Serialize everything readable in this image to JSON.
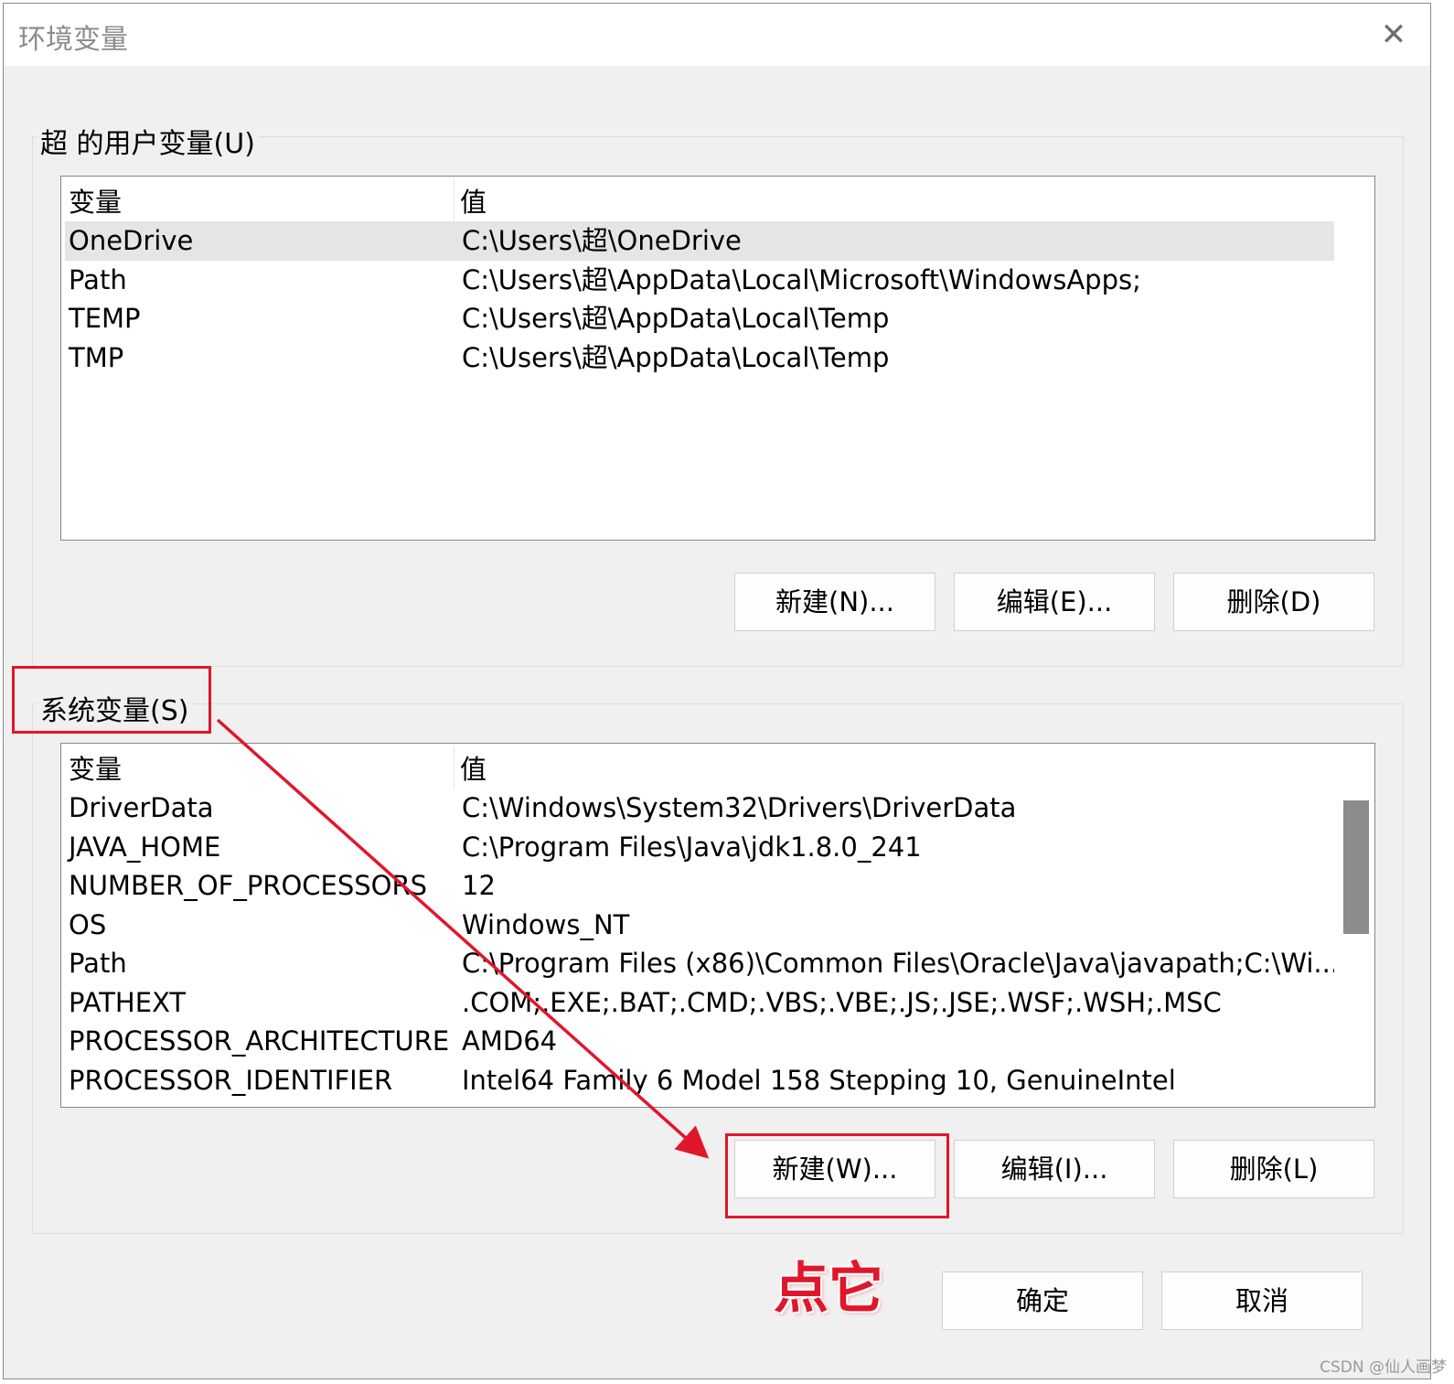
{
  "window": {
    "title": "环境变量",
    "close_label": "✕"
  },
  "user_vars": {
    "group_label": "超 的用户变量(U)",
    "columns": [
      "变量",
      "值"
    ],
    "rows": [
      {
        "name": "OneDrive",
        "value": "C:\\Users\\超\\OneDrive"
      },
      {
        "name": "Path",
        "value": "C:\\Users\\超\\AppData\\Local\\Microsoft\\WindowsApps;"
      },
      {
        "name": "TEMP",
        "value": "C:\\Users\\超\\AppData\\Local\\Temp"
      },
      {
        "name": "TMP",
        "value": "C:\\Users\\超\\AppData\\Local\\Temp"
      }
    ],
    "buttons": {
      "new": "新建(N)...",
      "edit": "编辑(E)...",
      "delete": "删除(D)"
    }
  },
  "system_vars": {
    "group_label": "系统变量(S)",
    "columns": [
      "变量",
      "值"
    ],
    "rows": [
      {
        "name": "DriverData",
        "value": "C:\\Windows\\System32\\Drivers\\DriverData"
      },
      {
        "name": "JAVA_HOME",
        "value": "C:\\Program Files\\Java\\jdk1.8.0_241"
      },
      {
        "name": "NUMBER_OF_PROCESSORS",
        "value": "12"
      },
      {
        "name": "OS",
        "value": "Windows_NT"
      },
      {
        "name": "Path",
        "value": "C:\\Program Files (x86)\\Common Files\\Oracle\\Java\\javapath;C:\\Wi..."
      },
      {
        "name": "PATHEXT",
        "value": ".COM;.EXE;.BAT;.CMD;.VBS;.VBE;.JS;.JSE;.WSF;.WSH;.MSC"
      },
      {
        "name": "PROCESSOR_ARCHITECTURE",
        "value": "AMD64"
      },
      {
        "name": "PROCESSOR_IDENTIFIER",
        "value": "Intel64 Family 6 Model 158 Stepping 10, GenuineIntel"
      }
    ],
    "buttons": {
      "new": "新建(W)...",
      "edit": "编辑(I)...",
      "delete": "删除(L)"
    }
  },
  "footer": {
    "ok": "确定",
    "cancel": "取消"
  },
  "annotation": {
    "text": "点它",
    "color": "#e0162b"
  },
  "watermark": "CSDN @仙人画梦"
}
